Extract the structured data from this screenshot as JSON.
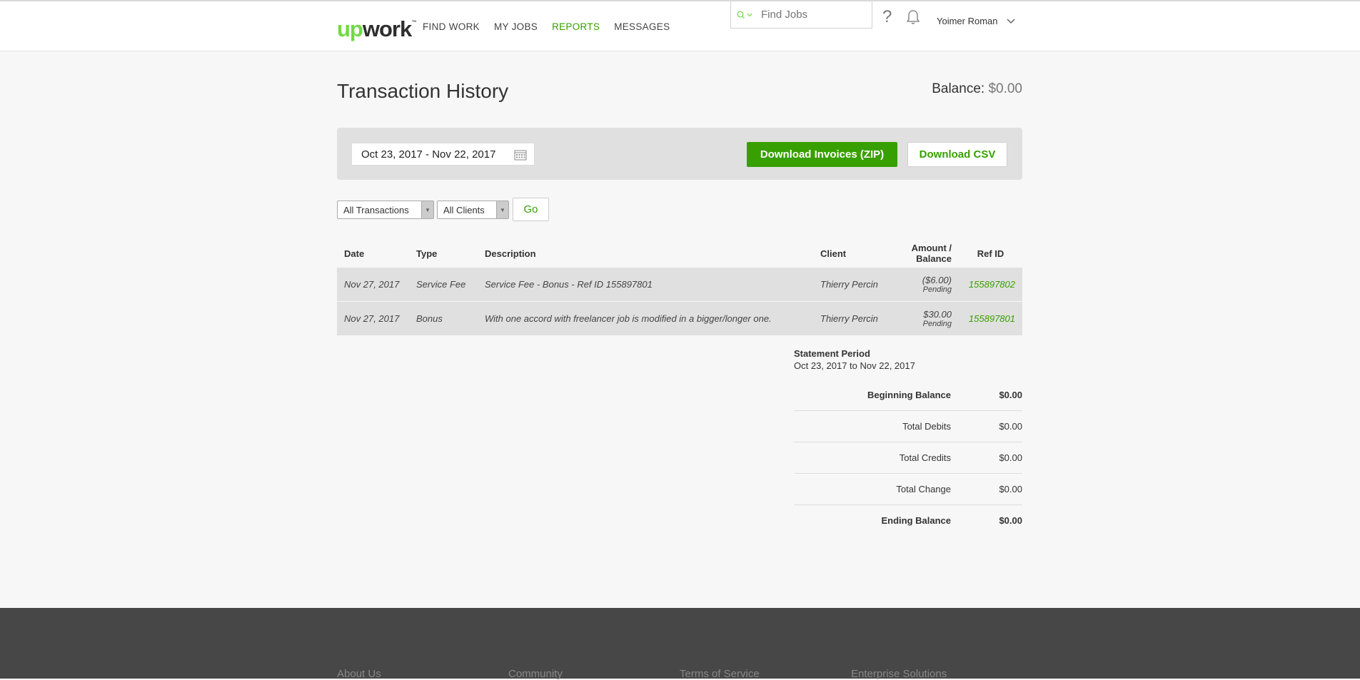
{
  "header": {
    "logo": {
      "up": "up",
      "work": "work",
      "tm": "™"
    },
    "nav": [
      "FIND WORK",
      "MY JOBS",
      "REPORTS",
      "MESSAGES"
    ],
    "search_placeholder": "Find Jobs",
    "help": "?",
    "user": "Yoimer Roman"
  },
  "page": {
    "title": "Transaction History",
    "balance_label": "Balance:",
    "balance_value": "$0.00"
  },
  "filters": {
    "date_range": "Oct 23, 2017 - Nov 22, 2017",
    "download_zip": "Download Invoices (ZIP)",
    "download_csv": "Download CSV",
    "transactions_select": "All Transactions",
    "clients_select": "All Clients",
    "go": "Go"
  },
  "table": {
    "headers": {
      "date": "Date",
      "type": "Type",
      "description": "Description",
      "client": "Client",
      "amount_1": "Amount /",
      "amount_2": "Balance",
      "ref": "Ref ID"
    },
    "rows": [
      {
        "date": "Nov 27, 2017",
        "type": "Service Fee",
        "description": "Service Fee - Bonus - Ref ID 155897801",
        "client": "Thierry Percin",
        "amount": "($6.00)",
        "balance": "Pending",
        "ref": "155897802"
      },
      {
        "date": "Nov 27, 2017",
        "type": "Bonus",
        "description": "With one accord with freelancer job is modified in a bigger/longer one.",
        "client": "Thierry Percin",
        "amount": "$30.00",
        "balance": "Pending",
        "ref": "155897801"
      }
    ]
  },
  "summary": {
    "period_label": "Statement Period",
    "period_value": "Oct 23, 2017 to Nov 22, 2017",
    "rows": [
      {
        "label": "Beginning Balance",
        "value": "$0.00"
      },
      {
        "label": "Total Debits",
        "value": "$0.00"
      },
      {
        "label": "Total Credits",
        "value": "$0.00"
      },
      {
        "label": "Total Change",
        "value": "$0.00"
      },
      {
        "label": "Ending Balance",
        "value": "$0.00"
      }
    ]
  },
  "footer": {
    "links": [
      "About Us",
      "Community",
      "Terms of Service",
      "Enterprise Solutions"
    ]
  },
  "colors": {
    "brand_green": "#37a000",
    "logo_green": "#6fda44"
  }
}
